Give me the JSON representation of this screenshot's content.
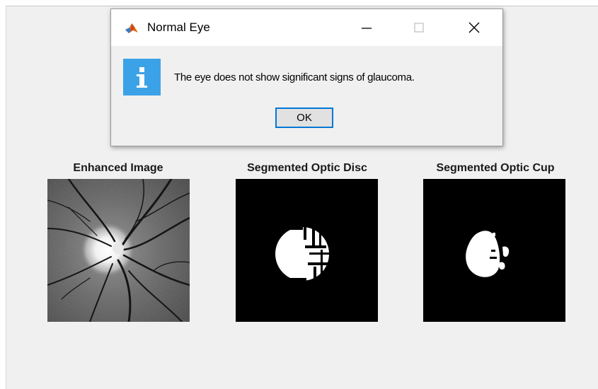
{
  "dialog": {
    "title": "Normal Eye",
    "message": "The eye does not show significant signs of glaucoma.",
    "ok_label": "OK",
    "info_color": "#3ca2e7",
    "focus_color": "#0078d7"
  },
  "figure": {
    "panels": [
      {
        "title": "Enhanced Image",
        "image": "retinal-fundus-grayscale"
      },
      {
        "title": "Segmented Optic Disc",
        "image": "binary-optic-disc-mask"
      },
      {
        "title": "Segmented Optic Cup",
        "image": "binary-optic-cup-mask"
      }
    ]
  }
}
